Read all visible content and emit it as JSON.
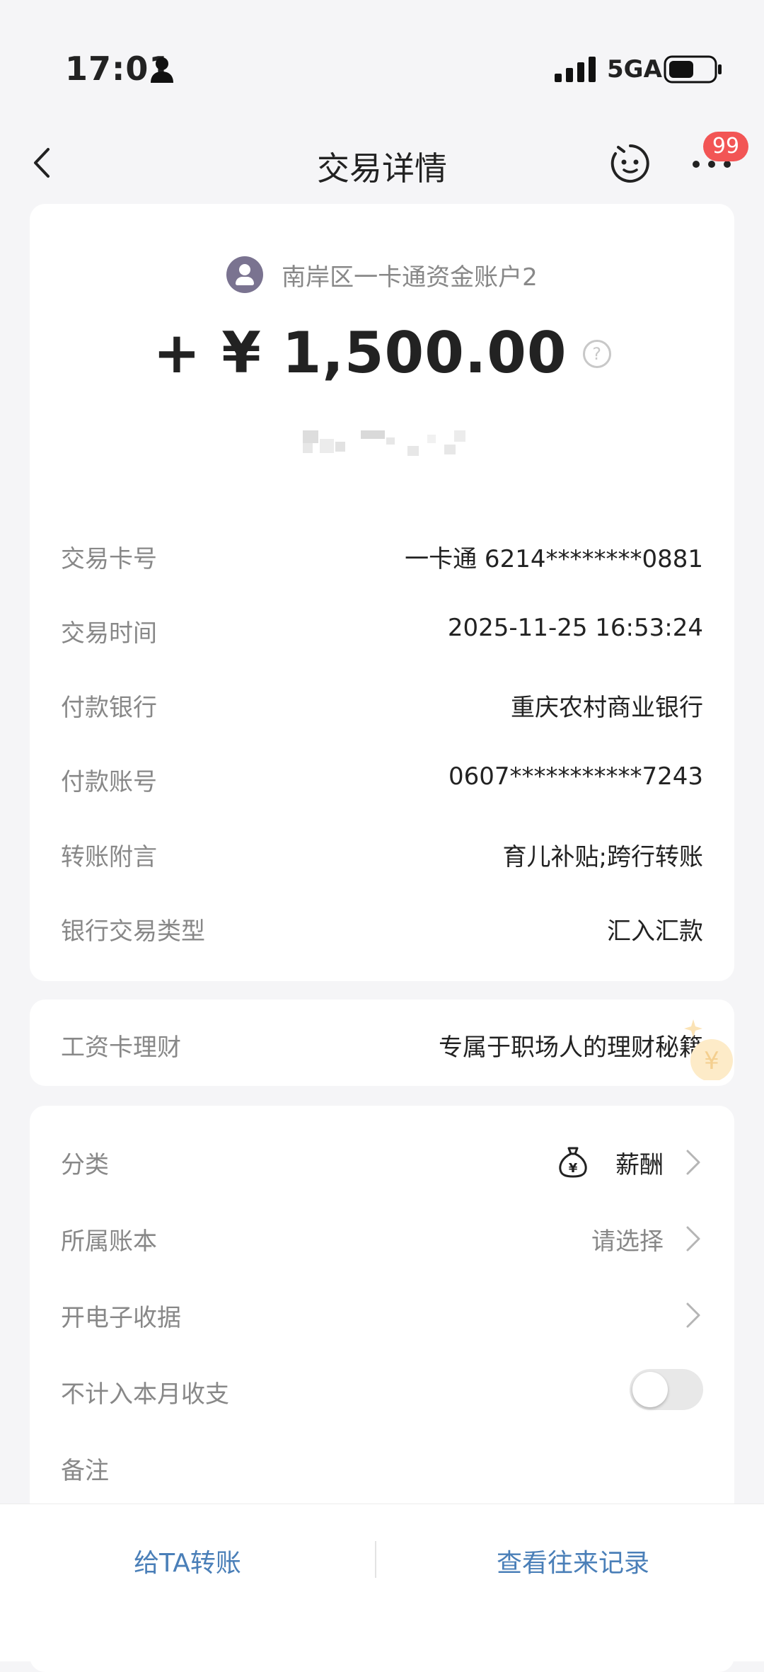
{
  "status_bar": {
    "time": "17:01",
    "network": "5GA",
    "icons": [
      "person-icon",
      "signal-icon",
      "battery-icon"
    ]
  },
  "nav": {
    "title": "交易详情",
    "badge": "99",
    "icons": [
      "back-icon",
      "robot-assistant-icon",
      "more-icon"
    ]
  },
  "transaction": {
    "account_name": "南岸区一卡通资金账户2",
    "amount": "+ ¥ 1,500.00",
    "details": [
      {
        "label": "交易卡号",
        "value": "一卡通 6214********0881"
      },
      {
        "label": "交易时间",
        "value": "2025-11-25 16:53:24"
      },
      {
        "label": "付款银行",
        "value": "重庆农村商业银行"
      },
      {
        "label": "付款账号",
        "value": "0607***********7243"
      },
      {
        "label": "转账附言",
        "value": "育儿补贴;跨行转账"
      },
      {
        "label": "银行交易类型",
        "value": "汇入汇款"
      }
    ]
  },
  "promo": {
    "label": "工资卡理财",
    "value": "专属于职场人的理财秘籍"
  },
  "extra": {
    "category": {
      "label": "分类",
      "value": "薪酬",
      "icon": "money-bag-icon"
    },
    "ledger": {
      "label": "所属账本",
      "value": "请选择"
    },
    "receipt": {
      "label": "开电子收据"
    },
    "exclude": {
      "label": "不计入本月收支",
      "toggle_on": false
    },
    "note": {
      "label": "备注"
    }
  },
  "bottom": {
    "transfer": "给TA转账",
    "history": "查看往来记录"
  },
  "colors": {
    "background": "#f5f5f7",
    "badge": "#f25555",
    "link": "#4a7fb8"
  }
}
